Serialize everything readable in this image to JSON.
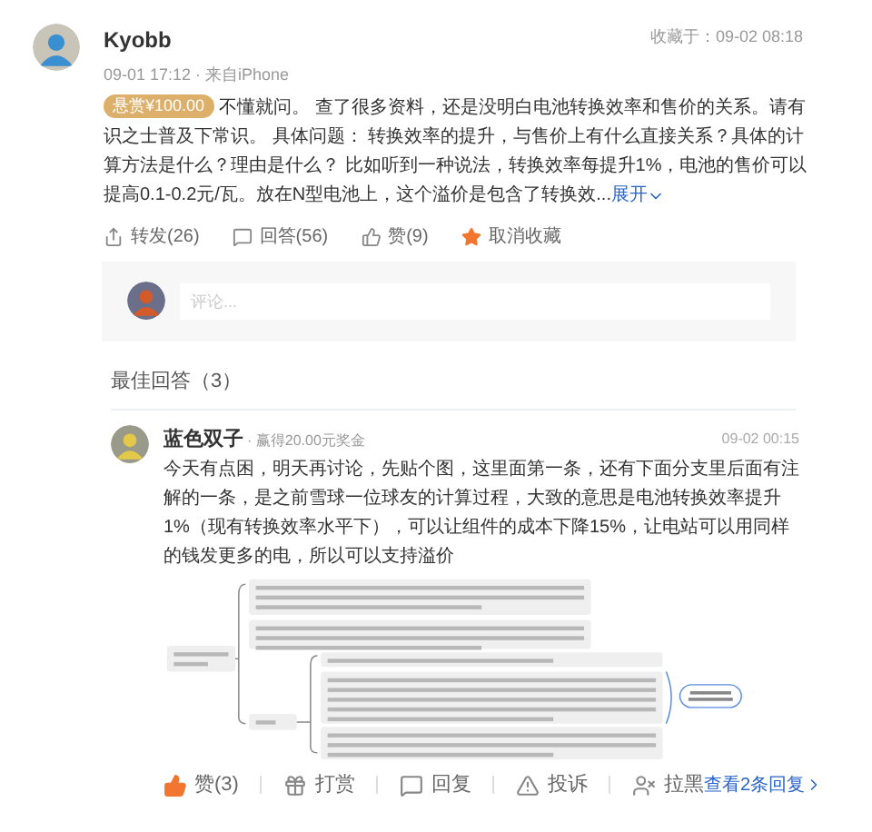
{
  "question": {
    "author": "Kyobb",
    "meta": "09-01 17:12 · 来自iPhone",
    "saved_at": "收藏于：09-02 08:18",
    "bounty": "悬赏¥100.00",
    "text": "不懂就问。 查了很多资料，还是没明白电池转换效率和售价的关系。请有识之士普及下常识。 具体问题： 转换效率的提升，与售价上有什么直接关系？具体的计算方法是什么？理由是什么？ 比如听到一种说法，转换效率每提升1%，电池的售价可以提高0.1-0.2元/瓦。放在N型电池上，这个溢价是包含了转换效...",
    "expand": "展开",
    "actions": [
      {
        "kind": "repost",
        "label": "转发(26)",
        "active": false
      },
      {
        "kind": "reply",
        "label": "回答(56)",
        "active": false
      },
      {
        "kind": "like",
        "label": "赞(9)",
        "active": false
      },
      {
        "kind": "star",
        "label": "取消收藏",
        "active": true
      }
    ]
  },
  "comment_box": {
    "placeholder": "评论..."
  },
  "answers_heading": "最佳回答（3）",
  "answer": {
    "author": "蓝色双子",
    "reward": "· 赢得20.00元奖金",
    "time": "09-02 00:15",
    "text": "今天有点困，明天再讨论，先贴个图，这里面第一条，还有下面分支里后面有注解的一条，是之前雪球一位球友的计算过程，大致的意思是电池转换效率提升1%（现有转换效率水平下），可以让组件的成本下降15%，让电站可以用同样的钱发更多的电，所以可以支持溢价",
    "actions": [
      {
        "kind": "like",
        "label": "赞(3)",
        "active": true
      },
      {
        "kind": "tip",
        "label": "打赏",
        "active": false
      },
      {
        "kind": "reply",
        "label": "回复",
        "active": false
      },
      {
        "kind": "report",
        "label": "投诉",
        "active": false
      },
      {
        "kind": "block",
        "label": "拉黑",
        "active": false
      }
    ],
    "more_replies": "查看2条回复"
  }
}
